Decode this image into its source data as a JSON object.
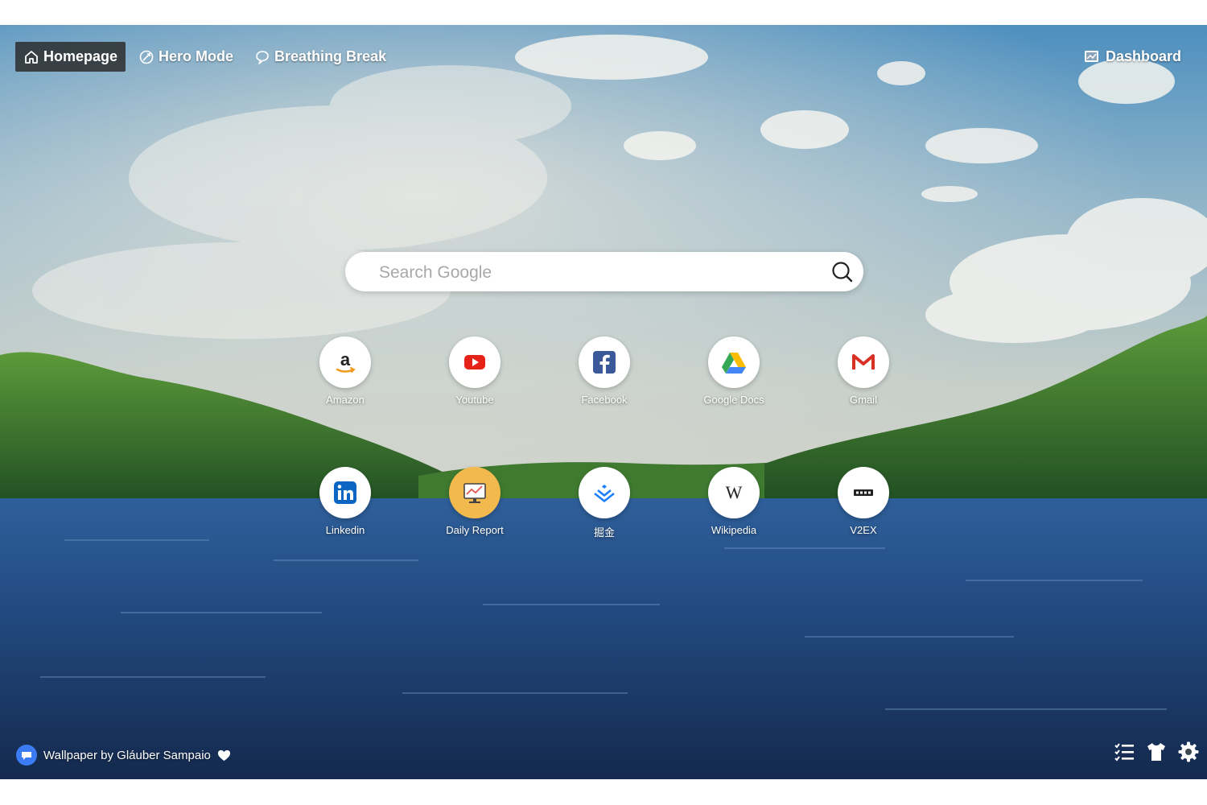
{
  "nav": {
    "items": [
      {
        "label": "Homepage",
        "icon": "home-icon",
        "active": true
      },
      {
        "label": "Hero Mode",
        "icon": "hero-mode-icon",
        "active": false
      },
      {
        "label": "Breathing Break",
        "icon": "breathing-icon",
        "active": false
      }
    ],
    "dashboard_label": "Dashboard"
  },
  "search": {
    "placeholder": "Search Google"
  },
  "shortcuts": [
    {
      "label": "Amazon",
      "icon": "amazon-icon"
    },
    {
      "label": "Youtube",
      "icon": "youtube-icon"
    },
    {
      "label": "Facebook",
      "icon": "facebook-icon"
    },
    {
      "label": "Google Docs",
      "icon": "google-drive-icon"
    },
    {
      "label": "Gmail",
      "icon": "gmail-icon"
    },
    {
      "label": "Linkedin",
      "icon": "linkedin-icon"
    },
    {
      "label": "Daily Report",
      "icon": "daily-report-icon"
    },
    {
      "label": "掘金",
      "icon": "juejin-icon"
    },
    {
      "label": "Wikipedia",
      "icon": "wikipedia-icon"
    },
    {
      "label": "V2EX",
      "icon": "v2ex-icon"
    }
  ],
  "footer": {
    "credit": "Wallpaper by Gláuber Sampaio"
  },
  "colors": {
    "accent": "#3b7cf5",
    "active_nav_bg": "#282828",
    "youtube_red": "#e62117",
    "facebook_blue": "#3b5998",
    "linkedin_blue": "#0a66c2",
    "daily_report_amber": "#f2b94e"
  }
}
